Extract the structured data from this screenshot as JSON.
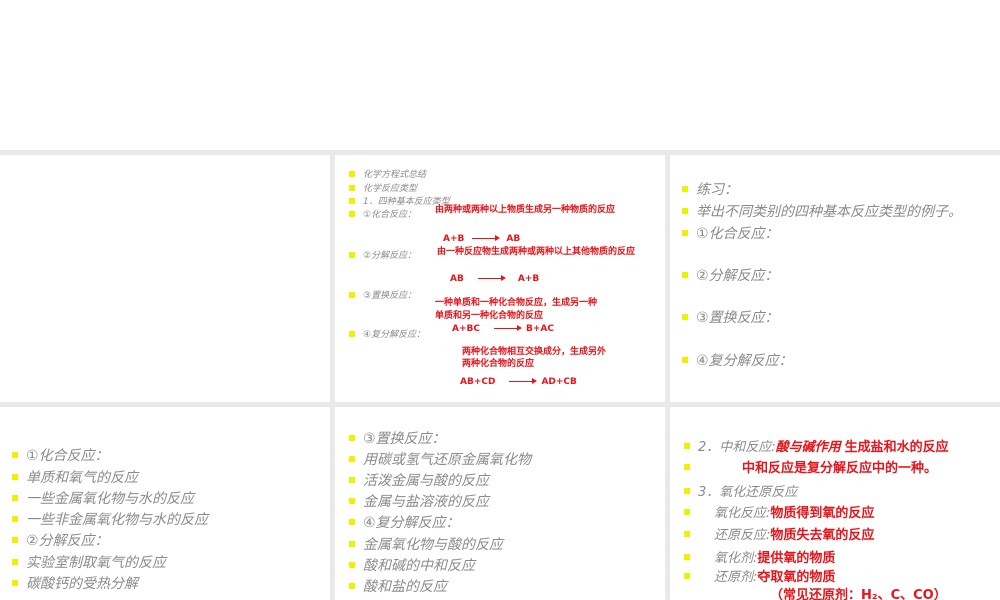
{
  "slide2": {
    "lines": [
      "化学方程式总结",
      "化学反应类型",
      "1．四种基本反应类型",
      "①化合反应：",
      "②分解反应：",
      "③置换反应：",
      "④复分解反应："
    ],
    "combination_def": "由两种或两种以上物质生成另一种物质的反应",
    "combination_eq": [
      "A+B",
      "AB"
    ],
    "decomposition_def": "由一种反应物生成两种或两种以上其他物质的反应",
    "decomposition_eq": [
      "AB",
      "A+B"
    ],
    "replacement_def_1": "一种单质和一种化合物反应，生成另一种",
    "replacement_def_2": "单质和另一种化合物的反应",
    "double_eq1": [
      "A+BC",
      "B+AC"
    ],
    "double_def_1": "两种化合物相互交换成分，生成另外",
    "double_def_2": "两种化合物的反应",
    "double_eq2": [
      "AB+CD",
      "AD+CB"
    ]
  },
  "slide3": {
    "lines": [
      "练习：",
      "举出不同类别的四种基本反应类型的例子。",
      "①化合反应：",
      "②分解反应：",
      "③置换反应：",
      "④复分解反应："
    ]
  },
  "slide4": {
    "lines": [
      "①化合反应：",
      "单质和氧气的反应",
      "一些金属氧化物与水的反应",
      "一些非金属氧化物与水的反应",
      "②分解反应：",
      "实验室制取氧气的反应",
      "碳酸钙的受热分解"
    ]
  },
  "slide5": {
    "lines": [
      "③置换反应：",
      "用碳或氢气还原金属氧化物",
      "活泼金属与酸的反应",
      "金属与盐溶液的反应",
      "④复分解反应：",
      "金属氧化物与酸的反应",
      "酸和碱的中和反应",
      "酸和盐的反应"
    ]
  },
  "slide6": {
    "neutral_label": "2．中和反应:",
    "neutral_red_italic": "酸与碱作用",
    "neutral_red": "生成盐和水的反应",
    "neutral_note": "中和反应是复分解反应中的一种。",
    "redox_label": "3．氧化还原反应",
    "items": [
      {
        "label": "氧化反应:",
        "value": "物质得到氧的反应"
      },
      {
        "label": "还原反应:",
        "value": "物质失去氧的反应"
      },
      {
        "label": "氧化剂:",
        "value": "提供氧的物质"
      },
      {
        "label": "还原剂:",
        "value": "夺取氧的物质"
      }
    ],
    "reducers": "（常见还原剂：H₂、C、CO）"
  }
}
